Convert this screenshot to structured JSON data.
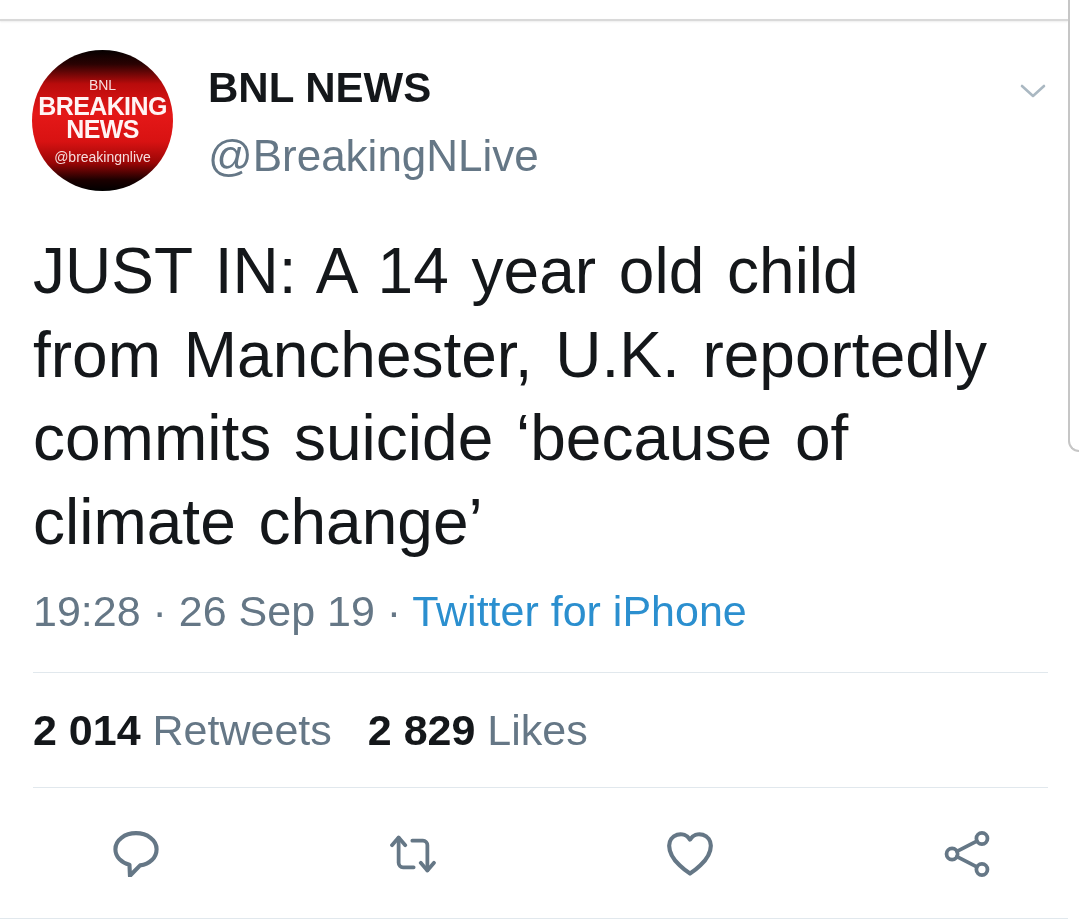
{
  "tweet": {
    "author": {
      "avatar": {
        "lines": [
          {
            "text": "BNL",
            "kind": "small"
          },
          {
            "text": "BREAKING",
            "kind": "large"
          },
          {
            "text": "NEWS",
            "kind": "large"
          },
          {
            "text": "@breakingnlive",
            "kind": "small"
          }
        ]
      },
      "name": "BNL NEWS",
      "handle": "@BreakingNLive"
    },
    "text": "JUST IN: A 14 year old child from Manchester, U.K. reportedly commits suicide ‘because of climate change’",
    "timestamp": "19:28 · 26 Sep 19 ·",
    "source": "Twitter for iPhone",
    "stats": [
      {
        "count": "2 014",
        "label": "Retweets"
      },
      {
        "count": "2 829",
        "label": "Likes"
      }
    ],
    "actions": [
      {
        "kind": "reply"
      },
      {
        "kind": "retweet"
      },
      {
        "kind": "like"
      },
      {
        "kind": "share"
      }
    ]
  }
}
